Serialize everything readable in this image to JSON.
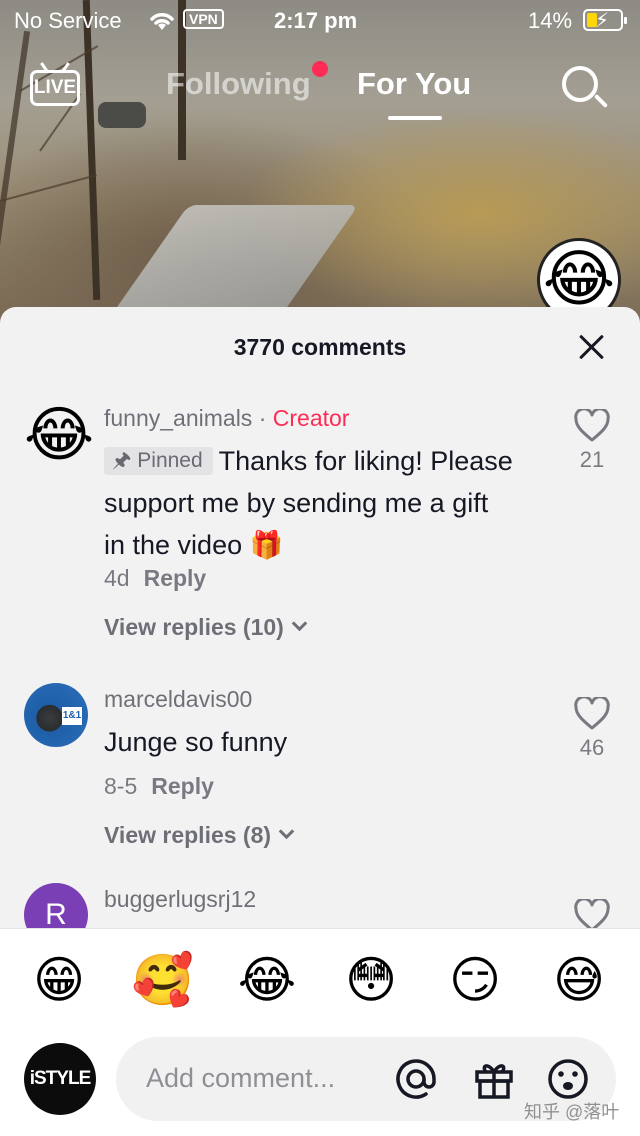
{
  "status_bar": {
    "carrier": "No Service",
    "vpn": "VPN",
    "time": "2:17 pm",
    "battery_pct": "14%"
  },
  "top_nav": {
    "live": "LIVE",
    "following": "Following",
    "for_you": "For You"
  },
  "comments_sheet": {
    "title": "3770 comments",
    "comments": [
      {
        "username": "funny_animals",
        "creator_sep": " · ",
        "creator_label": "Creator",
        "pinned_label": "Pinned",
        "text": "Thanks for liking! Please support me by sending me a gift in the video 🎁",
        "age": "4d",
        "reply": "Reply",
        "view_replies": "View replies (10)",
        "likes": "21"
      },
      {
        "username": "marceldavis00",
        "text": "Junge so funny",
        "age": "8-5",
        "reply": "Reply",
        "view_replies": "View replies (8)",
        "likes": "46",
        "avatar_text": "1&1"
      },
      {
        "username": "buggerlugsrj12",
        "avatar_letter": "R"
      }
    ]
  },
  "emoji_bar": [
    "😁",
    "🥰",
    "😂",
    "😳",
    "😏",
    "😅"
  ],
  "input": {
    "my_avatar": "iSTYLE",
    "placeholder": "Add comment..."
  },
  "watermark": "知乎 @落叶",
  "colors": {
    "accent": "#fe2c55",
    "sheet_bg": "#f2f2f3",
    "text": "#161823"
  }
}
